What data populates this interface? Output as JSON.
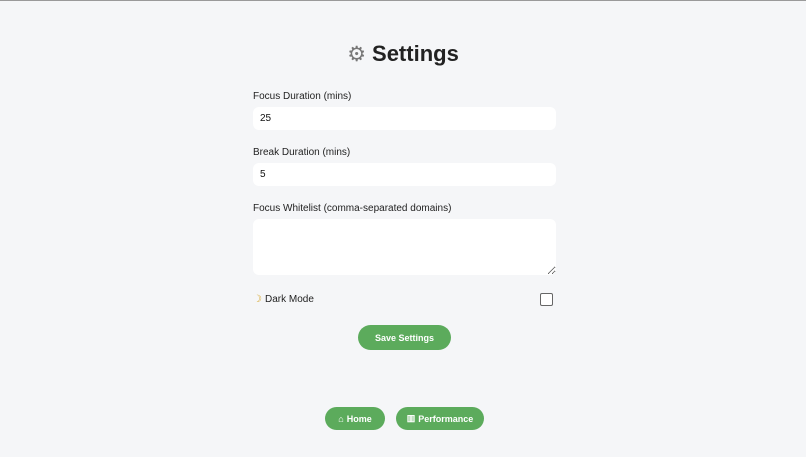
{
  "page": {
    "title": "Settings",
    "title_icon": "gear-icon"
  },
  "form": {
    "focus_duration": {
      "label": "Focus Duration (mins)",
      "value": "25"
    },
    "break_duration": {
      "label": "Break Duration (mins)",
      "value": "5"
    },
    "whitelist": {
      "label": "Focus Whitelist (comma-separated domains)",
      "value": ""
    },
    "dark_mode": {
      "label": "Dark Mode",
      "icon": "moon-icon",
      "checked": false
    },
    "save_label": "Save Settings"
  },
  "nav": {
    "home": {
      "label": "Home",
      "icon": "house-icon"
    },
    "performance": {
      "label": "Performance",
      "icon": "bar-chart-icon"
    }
  },
  "colors": {
    "accent": "#5cab5c",
    "background": "#f5f6f8"
  }
}
